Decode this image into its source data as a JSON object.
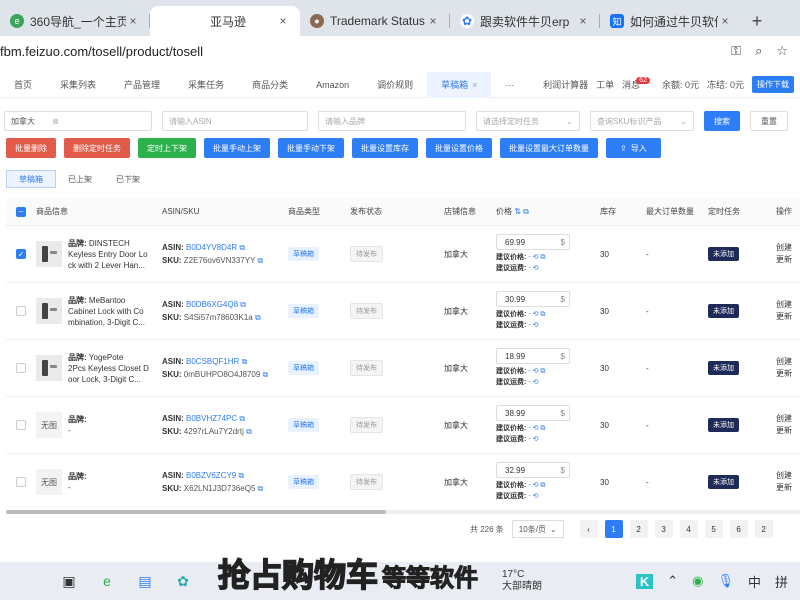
{
  "browser_tabs": [
    {
      "label": "360导航_一个主页，",
      "icon": "360-icon"
    },
    {
      "label": "亚马逊",
      "icon": "",
      "active": true
    },
    {
      "label": "Trademark Status",
      "icon": "avatar-icon"
    },
    {
      "label": "跟卖软件牛贝erp",
      "icon": "paw-icon"
    },
    {
      "label": "如何通过牛贝软件",
      "icon": "zhihu-icon"
    }
  ],
  "address": {
    "url": "fbm.feizuo.com/tosell/product/tosell"
  },
  "nav": {
    "tabs": [
      "首页",
      "采集列表",
      "产品管理",
      "采集任务",
      "商品分类",
      "Amazon",
      "调价规则",
      "草稿箱",
      "···"
    ],
    "active_close": "×",
    "right": {
      "calc": "利润计算器",
      "ticket": "工单",
      "msg": "消息",
      "msg_count": "62",
      "balance": "余额: 0元",
      "frozen": "冻结: 0元",
      "guide": "操作下载"
    }
  },
  "filters": {
    "country": "加拿大",
    "country_clear": "⊗",
    "asin_ph": "请输入ASIN",
    "brand_ph": "请输入品牌",
    "task_ph": "请选择定时任务",
    "sku_ph": "查询SKU标识产品",
    "search": "搜索",
    "reset": "重置"
  },
  "actions": {
    "batch_delete": "批量删除",
    "delete_timer": "删除定时任务",
    "timer_updown": "定时上下架",
    "manual_up": "批量手动上架",
    "manual_down": "批量手动下架",
    "set_stock": "批量设置库存",
    "set_price": "批量设置价格",
    "set_max": "批量设置最大订单数量",
    "import": "导入",
    "import_icon": "⇪"
  },
  "subtabs": [
    "草稿箱",
    "已上架",
    "已下架"
  ],
  "columns": {
    "info": "商品信息",
    "asin": "ASIN/SKU",
    "type": "商品类型",
    "status": "发布状态",
    "shop": "店铺信息",
    "price": "价格",
    "stock": "库存",
    "max": "最大订单数量",
    "timer": "定时任务",
    "op": "操作"
  },
  "labels": {
    "brand": "品牌:",
    "asin": "ASIN:",
    "sku": "SKU:",
    "suggest_price": "建议价格:",
    "suggest_freight": "建议运费:",
    "no_image": "无图",
    "currency": "$",
    "op1": "创建",
    "op2": "更新"
  },
  "rows": [
    {
      "checked": true,
      "brand": "DINSTECH",
      "title1": "Keyless Entry Door Lo",
      "title2": "ck with 2 Lever Han...",
      "asin": "B0D4YV8D4R",
      "sku": "Z2E76ov6VN337YY",
      "type": "草稿箱",
      "status": "待发布",
      "shop": "加拿大",
      "price": "69.99",
      "stock": "30",
      "max": "-",
      "timer": "未添加",
      "img": true
    },
    {
      "checked": false,
      "brand": "MeBantoo",
      "title1": "Cabinet Lock with Co",
      "title2": "mbination, 3-Digit C...",
      "asin": "B0DB6XG4Q8",
      "sku": "S4Si57m78603K1a",
      "type": "草稿箱",
      "status": "待发布",
      "shop": "加拿大",
      "price": "30.99",
      "stock": "30",
      "max": "-",
      "timer": "未添加",
      "img": true
    },
    {
      "checked": false,
      "brand": "YogePote",
      "title1": "2Pcs Keyless Closet D",
      "title2": "oor Lock, 3-Digit C...",
      "asin": "B0CSBQF1HR",
      "sku": "0mBUHPO8O4J8709",
      "type": "草稿箱",
      "status": "待发布",
      "shop": "加拿大",
      "price": "18.99",
      "stock": "30",
      "max": "-",
      "timer": "未添加",
      "img": true
    },
    {
      "checked": false,
      "brand": "",
      "title1": "-",
      "title2": "",
      "asin": "B0BVHZ74PC",
      "sku": "4297rLAu7Y2drtj",
      "type": "草稿箱",
      "status": "待发布",
      "shop": "加拿大",
      "price": "38.99",
      "stock": "30",
      "max": "-",
      "timer": "未添加",
      "img": false
    },
    {
      "checked": false,
      "brand": "",
      "title1": "-",
      "title2": "",
      "asin": "B0BZV6ZCY9",
      "sku": "X62LN1J3D736eQ5",
      "type": "草稿箱",
      "status": "待发布",
      "shop": "加拿大",
      "price": "32.99",
      "stock": "30",
      "max": "-",
      "timer": "未添加",
      "img": false
    }
  ],
  "pager": {
    "total": "共 226 条",
    "size": "10条/页",
    "pages": [
      "1",
      "2",
      "3",
      "4",
      "5",
      "6",
      "2"
    ],
    "prev": "‹"
  },
  "subtitle": {
    "yellow": "抢占购物车",
    "white": "等等软件"
  },
  "taskbar": {
    "temp": "17°C",
    "weather": "大部晴朗",
    "ime": "中",
    "ime2": "拼"
  }
}
